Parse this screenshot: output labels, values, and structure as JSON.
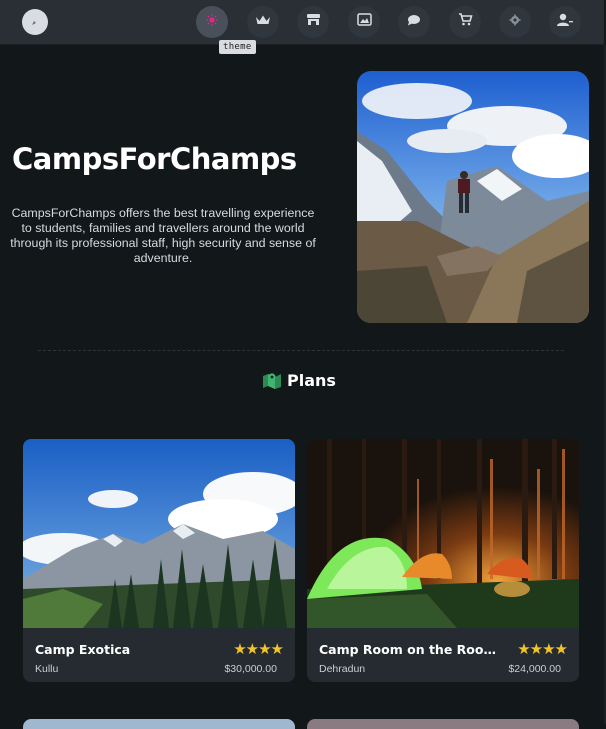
{
  "nav": {
    "tooltip": "theme",
    "items": [
      {
        "icon": "theme-icon",
        "active": true
      },
      {
        "icon": "crown-icon"
      },
      {
        "icon": "store-icon"
      },
      {
        "icon": "gallery-icon"
      },
      {
        "icon": "chat-icon"
      },
      {
        "icon": "cart-icon"
      },
      {
        "icon": "settings-icon"
      },
      {
        "icon": "user-menu-icon"
      }
    ]
  },
  "hero": {
    "title": "CampsForChamps",
    "description": "CampsForChamps offers the best travelling experience to students, families and travellers around the world through its professional staff, high security and sense of adventure."
  },
  "plans": {
    "heading": "Plans",
    "cards": [
      {
        "title": "Camp Exotica",
        "location": "Kullu",
        "price": "$30,000.00",
        "rating": 4,
        "stars": "★★★★"
      },
      {
        "title": "Camp Room on the Roof, Dehradun",
        "location": "Dehradun",
        "price": "$24,000.00",
        "rating": 4,
        "stars": "★★★★"
      }
    ]
  },
  "colors": {
    "background": "#12171a",
    "nav": "#2a2f36",
    "card": "#262b31",
    "accent": "#e0278c",
    "star": "#f2c428",
    "map_icon": "#3fb56f"
  }
}
